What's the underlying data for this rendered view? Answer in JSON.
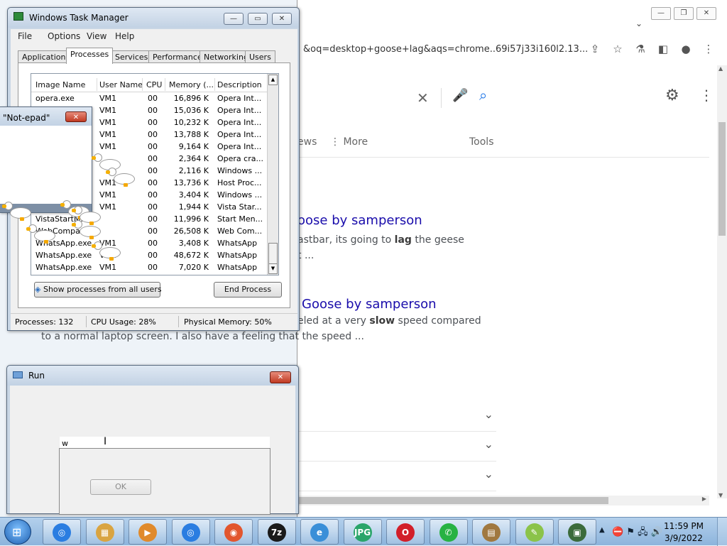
{
  "chrome": {
    "window_buttons": {
      "minimize": "—",
      "maximize": "❐",
      "close": "✕"
    },
    "tab_dropdown": "⌄",
    "url_text": "&oq=desktop+goose+lag&aqs=chrome..69i57j33i160l2.13...",
    "toolbar_icons": {
      "share": "⇪",
      "star": "☆",
      "extensions": "⚗",
      "sidepanel": "◧",
      "profile": "●",
      "menu": "⋮"
    },
    "search": {
      "clear": "✕",
      "mic": "🎤",
      "search": "⌕",
      "settings": "⚙",
      "apps": "⋮"
    },
    "nav": {
      "news_partial": "ews",
      "more": "⋮ More",
      "tools": "Tools"
    },
    "results": [
      {
        "title": "oose by samperson",
        "snippet_pre": "astbar, its going to ",
        "snippet_bold": "lag",
        "snippet_post": " the geese",
        "snippet2": "t ..."
      },
      {
        "title": "Goose by samperson",
        "snippet_pre": "eled at a very ",
        "snippet_bold": "slow",
        "snippet_post": " speed compared",
        "snippet2": "to a normal laptop screen. I also have a feeling that the speed ..."
      }
    ],
    "faq_chevrons": [
      "⌄",
      "⌄",
      "⌄"
    ]
  },
  "task_manager": {
    "title": "Windows Task Manager",
    "window_buttons": {
      "minimize": "—",
      "maximize": "▭",
      "close": "✕"
    },
    "menu": [
      "File",
      "Options",
      "View",
      "Help"
    ],
    "tabs": [
      "Applications",
      "Processes",
      "Services",
      "Performance",
      "Networking",
      "Users"
    ],
    "active_tab": "Processes",
    "columns": [
      "Image Name",
      "User Name",
      "CPU",
      "Memory (...",
      "Description"
    ],
    "rows": [
      {
        "image": "opera.exe",
        "user": "VM1",
        "cpu": "00",
        "mem": "16,896 K",
        "desc": "Opera Int..."
      },
      {
        "image": "",
        "user": "VM1",
        "cpu": "00",
        "mem": "15,036 K",
        "desc": "Opera Int..."
      },
      {
        "image": "",
        "user": "VM1",
        "cpu": "00",
        "mem": "10,232 K",
        "desc": "Opera Int..."
      },
      {
        "image": "",
        "user": "VM1",
        "cpu": "00",
        "mem": "13,788 K",
        "desc": "Opera Int..."
      },
      {
        "image": "",
        "user": "VM1",
        "cpu": "00",
        "mem": "9,164 K",
        "desc": "Opera Int..."
      },
      {
        "image": "",
        "user": "",
        "cpu": "00",
        "mem": "2,364 K",
        "desc": "Opera cra..."
      },
      {
        "image": "",
        "user": "",
        "cpu": "00",
        "mem": "2,116 K",
        "desc": "Windows ..."
      },
      {
        "image": "",
        "user": "VM1",
        "cpu": "00",
        "mem": "13,736 K",
        "desc": "Host Proc..."
      },
      {
        "image": "",
        "user": "VM1",
        "cpu": "00",
        "mem": "3,404 K",
        "desc": "Windows ..."
      },
      {
        "image": "",
        "user": "VM1",
        "cpu": "00",
        "mem": "1,944 K",
        "desc": "Vista Star..."
      },
      {
        "image": "VistaStartM...",
        "user": "",
        "cpu": "00",
        "mem": "11,996 K",
        "desc": "Start Men..."
      },
      {
        "image": "WebCompani...",
        "user": "",
        "cpu": "00",
        "mem": "26,508 K",
        "desc": "Web Com..."
      },
      {
        "image": "WhatsApp.exe",
        "user": "VM1",
        "cpu": "00",
        "mem": "3,408 K",
        "desc": "WhatsApp"
      },
      {
        "image": "WhatsApp.exe",
        "user": "VM1",
        "cpu": "00",
        "mem": "48,672 K",
        "desc": "WhatsApp"
      },
      {
        "image": "WhatsApp.exe",
        "user": "VM1",
        "cpu": "00",
        "mem": "7,020 K",
        "desc": "WhatsApp"
      }
    ],
    "show_all_button": "Show processes from all users",
    "end_process_button": "End Process",
    "status": {
      "processes": "Processes: 132",
      "cpu": "CPU Usage: 28%",
      "memory": "Physical Memory: 50%"
    }
  },
  "notepad": {
    "title": "\"Not-epad\"",
    "close": "✕"
  },
  "run": {
    "title": "Run",
    "close": "✕",
    "input_value": "w",
    "caret": "I",
    "ok_button": "OK"
  },
  "taskbar": {
    "start": "⊞",
    "items": [
      "Chrome",
      "Explorer",
      "Media",
      "Chrome",
      "Firefox",
      "7z",
      "IE",
      "JPG",
      "Opera",
      "WhatsApp",
      "Zip",
      "Goose",
      "Task Manager"
    ],
    "item_labels": [
      "◎",
      "▦",
      "▶",
      "◎",
      "◉",
      "7z",
      "e",
      "JPG",
      "O",
      "✆",
      "▤",
      "✎",
      "▣"
    ],
    "item_colors": [
      "#2a7de1",
      "#d9a441",
      "#e08a2c",
      "#2a7de1",
      "#e2562e",
      "#1a1a1a",
      "#3a8fd8",
      "#2aa56a",
      "#d21f2a",
      "#27b243",
      "#a07840",
      "#8bc34a",
      "#3b6b3b"
    ],
    "tray_arrow": "▲",
    "tray_icons": "⛔ ⚑ 🖧 🔊",
    "time": "11:59 PM",
    "date": "3/9/2022"
  }
}
